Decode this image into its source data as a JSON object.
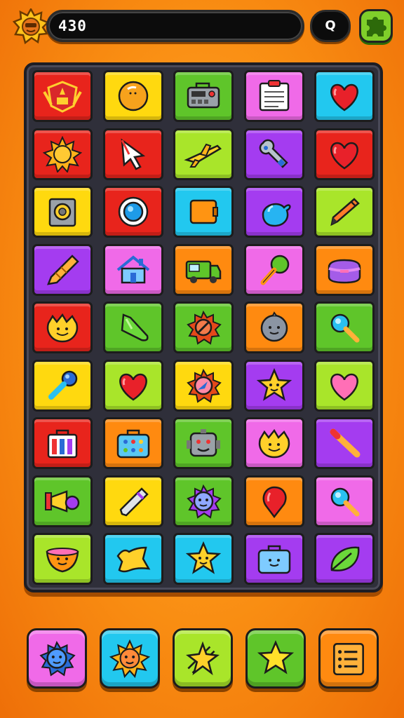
{
  "top_bar": {
    "score": "430",
    "search_label": "Q",
    "left_icon": "sun-badge-icon",
    "right_icon": "puzzle-piece-icon"
  },
  "colors": {
    "red": "#e8241c",
    "yellow": "#ffd90f",
    "green": "#5fc52a",
    "lime": "#a9e52a",
    "magenta": "#f06ae8",
    "cyan": "#22c8ef",
    "purple": "#a43cf0",
    "orange": "#ff8a10"
  },
  "board": {
    "rows": [
      [
        {
          "bg": "red",
          "icon": "crest-emblem-icon"
        },
        {
          "bg": "yellow",
          "icon": "orange-ball-icon"
        },
        {
          "bg": "green",
          "icon": "radio-device-icon"
        },
        {
          "bg": "magenta",
          "icon": "clipboard-icon"
        },
        {
          "bg": "cyan",
          "icon": "heart-icon"
        }
      ],
      [
        {
          "bg": "red",
          "icon": "sun-icon"
        },
        {
          "bg": "red",
          "icon": "cursor-arrow-icon"
        },
        {
          "bg": "lime",
          "icon": "airplane-icon"
        },
        {
          "bg": "purple",
          "icon": "wrench-icon"
        },
        {
          "bg": "red",
          "icon": "heart-icon"
        }
      ],
      [
        {
          "bg": "yellow",
          "icon": "speaker-icon"
        },
        {
          "bg": "red",
          "icon": "ring-icon"
        },
        {
          "bg": "cyan",
          "icon": "orange-block-icon"
        },
        {
          "bg": "purple",
          "icon": "water-drop-icon"
        },
        {
          "bg": "lime",
          "icon": "pencil-icon"
        }
      ],
      [
        {
          "bg": "purple",
          "icon": "crayon-icon"
        },
        {
          "bg": "magenta",
          "icon": "house-icon"
        },
        {
          "bg": "orange",
          "icon": "truck-icon"
        },
        {
          "bg": "magenta",
          "icon": "maraca-icon"
        },
        {
          "bg": "orange",
          "icon": "lunchbox-icon"
        }
      ],
      [
        {
          "bg": "red",
          "icon": "smiling-leaf-icon"
        },
        {
          "bg": "green",
          "icon": "green-pepper-icon"
        },
        {
          "bg": "green",
          "icon": "no-sign-gear-icon"
        },
        {
          "bg": "orange",
          "icon": "gray-blob-icon"
        },
        {
          "bg": "green",
          "icon": "magnifier-icon"
        }
      ],
      [
        {
          "bg": "yellow",
          "icon": "microphone-icon"
        },
        {
          "bg": "lime",
          "icon": "heart-icon"
        },
        {
          "bg": "yellow",
          "icon": "compass-gear-icon"
        },
        {
          "bg": "purple",
          "icon": "star-face-icon"
        },
        {
          "bg": "lime",
          "icon": "pink-heart-icon"
        }
      ],
      [
        {
          "bg": "red",
          "icon": "paint-tubes-icon"
        },
        {
          "bg": "orange",
          "icon": "toolbox-icon"
        },
        {
          "bg": "green",
          "icon": "robot-face-icon"
        },
        {
          "bg": "magenta",
          "icon": "smiling-leaf-icon"
        },
        {
          "bg": "purple",
          "icon": "baton-icon"
        }
      ],
      [
        {
          "bg": "green",
          "icon": "megaphone-icon"
        },
        {
          "bg": "yellow",
          "icon": "pen-icon"
        },
        {
          "bg": "green",
          "icon": "gear-face-icon"
        },
        {
          "bg": "orange",
          "icon": "red-balloon-icon"
        },
        {
          "bg": "magenta",
          "icon": "magnifier-icon"
        }
      ],
      [
        {
          "bg": "lime",
          "icon": "bowl-face-icon"
        },
        {
          "bg": "cyan",
          "icon": "banner-icon"
        },
        {
          "bg": "cyan",
          "icon": "star-face-icon"
        },
        {
          "bg": "purple",
          "icon": "case-face-icon"
        },
        {
          "bg": "purple",
          "icon": "leaf-icon"
        }
      ]
    ]
  },
  "toolbar": {
    "buttons": [
      {
        "bg": "magenta",
        "icon": "blue-gear-face-icon"
      },
      {
        "bg": "cyan",
        "icon": "sun-face-icon"
      },
      {
        "bg": "lime",
        "icon": "sparkle-star-icon"
      },
      {
        "bg": "green",
        "icon": "yellow-star-icon"
      },
      {
        "bg": "orange",
        "icon": "list-menu-icon"
      }
    ]
  }
}
